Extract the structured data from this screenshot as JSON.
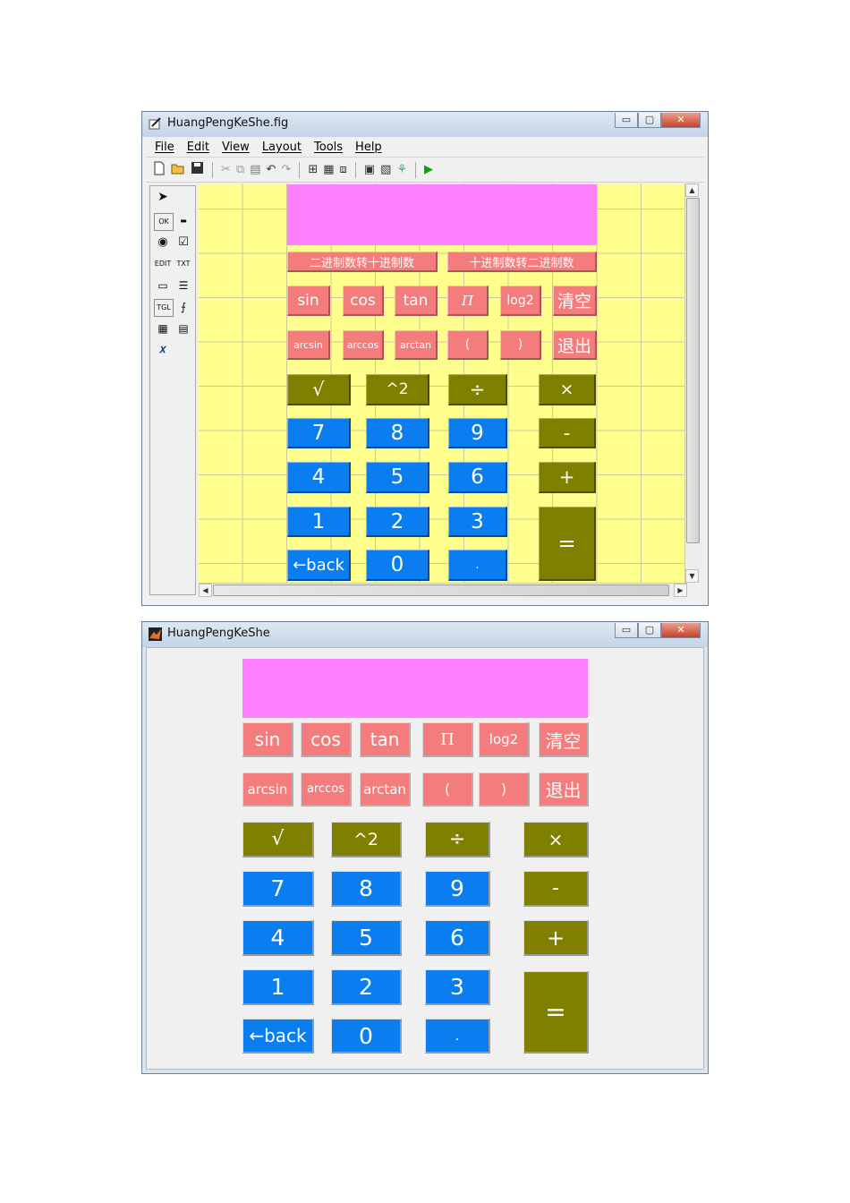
{
  "guide_window": {
    "title": "HuangPengKeShe.fig",
    "controls": {
      "minimize": "▭",
      "maximize": "▢",
      "close": "✕"
    },
    "menu": [
      "File",
      "Edit",
      "View",
      "Layout",
      "Tools",
      "Help"
    ],
    "toolbar_icons": [
      "new-icon",
      "open-icon",
      "save-icon",
      "cut-icon",
      "copy-icon",
      "paste-icon",
      "undo-icon",
      "redo-icon",
      "align-icon",
      "menu-editor-icon",
      "tab-order-icon",
      "mfile-editor-icon",
      "property-inspector-icon",
      "object-browser-icon",
      "run-icon"
    ],
    "palette": [
      "OK",
      "▬",
      "◉",
      "☑",
      "EDIT",
      "TXT",
      "▭",
      "☰",
      "TGL",
      "⨍",
      "▦",
      "▤",
      "𝑥"
    ],
    "display_text": "",
    "convert_buttons": [
      "二进制数转十进制数",
      "十进制数转二进制数"
    ],
    "rows": {
      "func1": [
        "sin",
        "cos",
        "tan",
        "Π",
        "log2",
        "清空"
      ],
      "func2": [
        "arcsin",
        "arccos",
        "arctan",
        "(",
        ")",
        "退出"
      ],
      "ops": [
        "√",
        "^2",
        "÷",
        "×"
      ],
      "row789": [
        "7",
        "8",
        "9",
        "-"
      ],
      "row456": [
        "4",
        "5",
        "6",
        "+"
      ],
      "row123": [
        "1",
        "2",
        "3",
        "="
      ],
      "row0": [
        "←back",
        "0",
        "."
      ]
    }
  },
  "figure_window": {
    "title": "HuangPengKeShe",
    "controls": {
      "minimize": "▭",
      "maximize": "▢",
      "close": "✕"
    },
    "display_text": "",
    "rows": {
      "func1": [
        "sin",
        "cos",
        "tan",
        "Π",
        "log2",
        "清空"
      ],
      "func2": [
        "arcsin",
        "arccos",
        "arctan",
        "(",
        ")",
        "退出"
      ],
      "ops": [
        "√",
        "^2",
        "÷",
        "×"
      ],
      "row789": [
        "7",
        "8",
        "9",
        "-"
      ],
      "row456": [
        "4",
        "5",
        "6",
        "+"
      ],
      "row123": [
        "1",
        "2",
        "3",
        "="
      ],
      "row0": [
        "←back",
        "0",
        "."
      ]
    }
  },
  "colors": {
    "display": "#ff80ff",
    "function_buttons": "#f47c7c",
    "operator_buttons": "#808000",
    "digit_buttons": "#0a7ef0",
    "grid_background": "#ffff8d",
    "figure_background": "#f0f0f0"
  }
}
